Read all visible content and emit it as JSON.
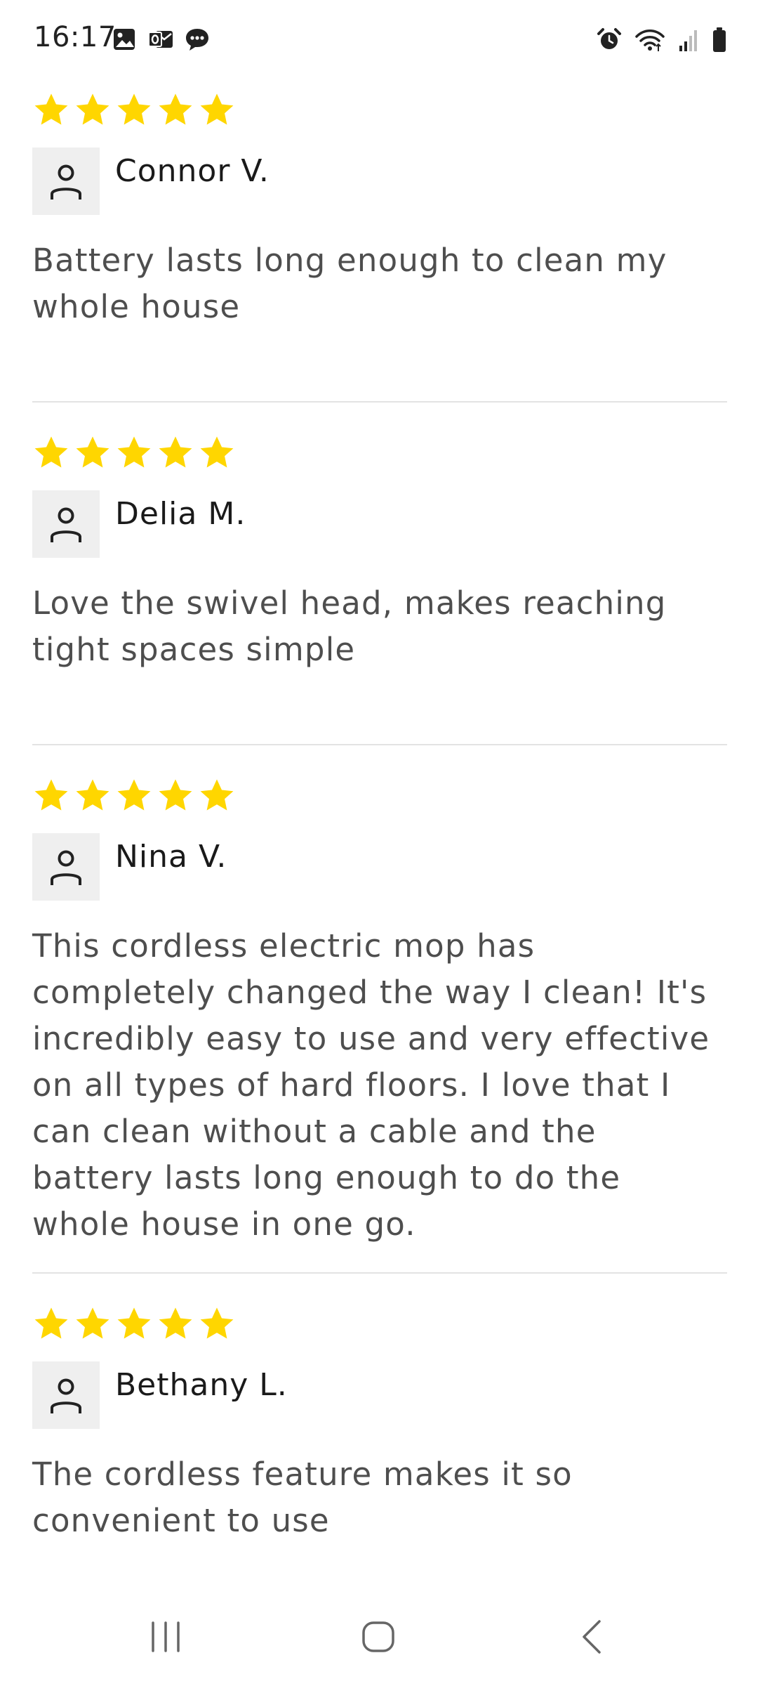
{
  "status_bar": {
    "time": "16:17",
    "left_icons": [
      "gallery-icon",
      "outlook-icon",
      "chat-bubble-icon"
    ],
    "right_icons": [
      "alarm-icon",
      "wifi-icon",
      "signal-icon",
      "battery-icon"
    ]
  },
  "colors": {
    "star": "#FFD600",
    "body_text": "#4e4e4e",
    "divider": "#e3e3e3",
    "avatar_bg": "#efefef"
  },
  "reviews": [
    {
      "rating": 5,
      "reviewer": "Connor V.",
      "body": "Battery lasts long enough to clean my whole house"
    },
    {
      "rating": 5,
      "reviewer": "Delia M.",
      "body": "Love the swivel head, makes reaching tight spaces simple"
    },
    {
      "rating": 5,
      "reviewer": "Nina V.",
      "body": "This cordless electric mop has completely changed the way I clean! It's incredibly easy to use and very effective on all types of hard floors. I love that I can clean without a cable and the battery lasts long enough to do the whole house in one go."
    },
    {
      "rating": 5,
      "reviewer": "Bethany L.",
      "body": "The cordless feature makes it so convenient to use"
    }
  ],
  "nav_bar": {
    "buttons": [
      "recent-apps-icon",
      "home-icon",
      "back-icon"
    ]
  }
}
